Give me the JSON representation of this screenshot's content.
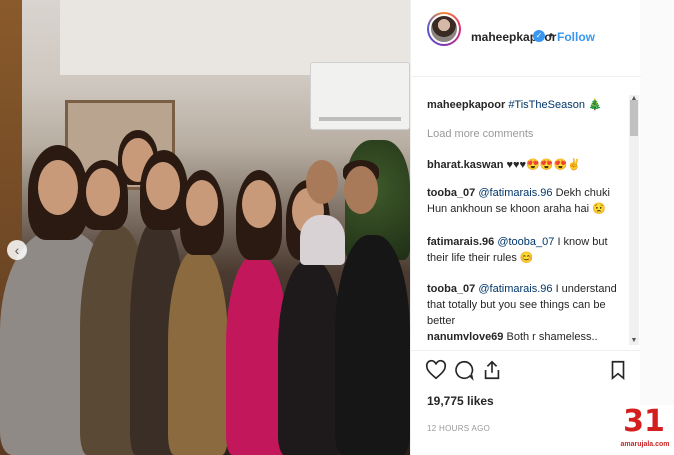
{
  "post": {
    "username": "maheepkapoor",
    "verified_mark": "✓",
    "separator": "•",
    "follow_label": "Follow",
    "caption_user": "maheepkapoor",
    "caption_text": "#TisTheSeason 🎄",
    "load_more": "Load more comments",
    "likes": "19,775 likes",
    "timestamp": "12 HOURS AGO"
  },
  "comments": [
    {
      "user": "bharat.kaswan",
      "mention": "",
      "text": "♥♥♥😍😍😍✌"
    },
    {
      "user": "tooba_07",
      "mention": "@fatimarais.96",
      "text": "Dekh chuki Hun ankhoun se khoon araha hai 😟"
    },
    {
      "user": "fatimarais.96",
      "mention": "@tooba_07",
      "text": "I know but their life their rules 😊"
    },
    {
      "user": "tooba_07",
      "mention": "@fatimarais.96",
      "text": "I understand that totally but you see things can be better"
    },
    {
      "user": "nanumvlove69",
      "mention": "",
      "text": "Both r shameless.. mailaika"
    }
  ],
  "icons": {
    "like": "heart-icon",
    "comment": "comment-icon",
    "share": "share-icon",
    "save": "bookmark-icon",
    "prev": "chevron-left-icon"
  },
  "prev_glyph": "‹",
  "watermark": {
    "logo": "31",
    "site": "amarujala.com"
  },
  "colors": {
    "accent": "#3897f0",
    "text": "#262626",
    "muted": "#999999",
    "watermark": "#d41f1f"
  }
}
